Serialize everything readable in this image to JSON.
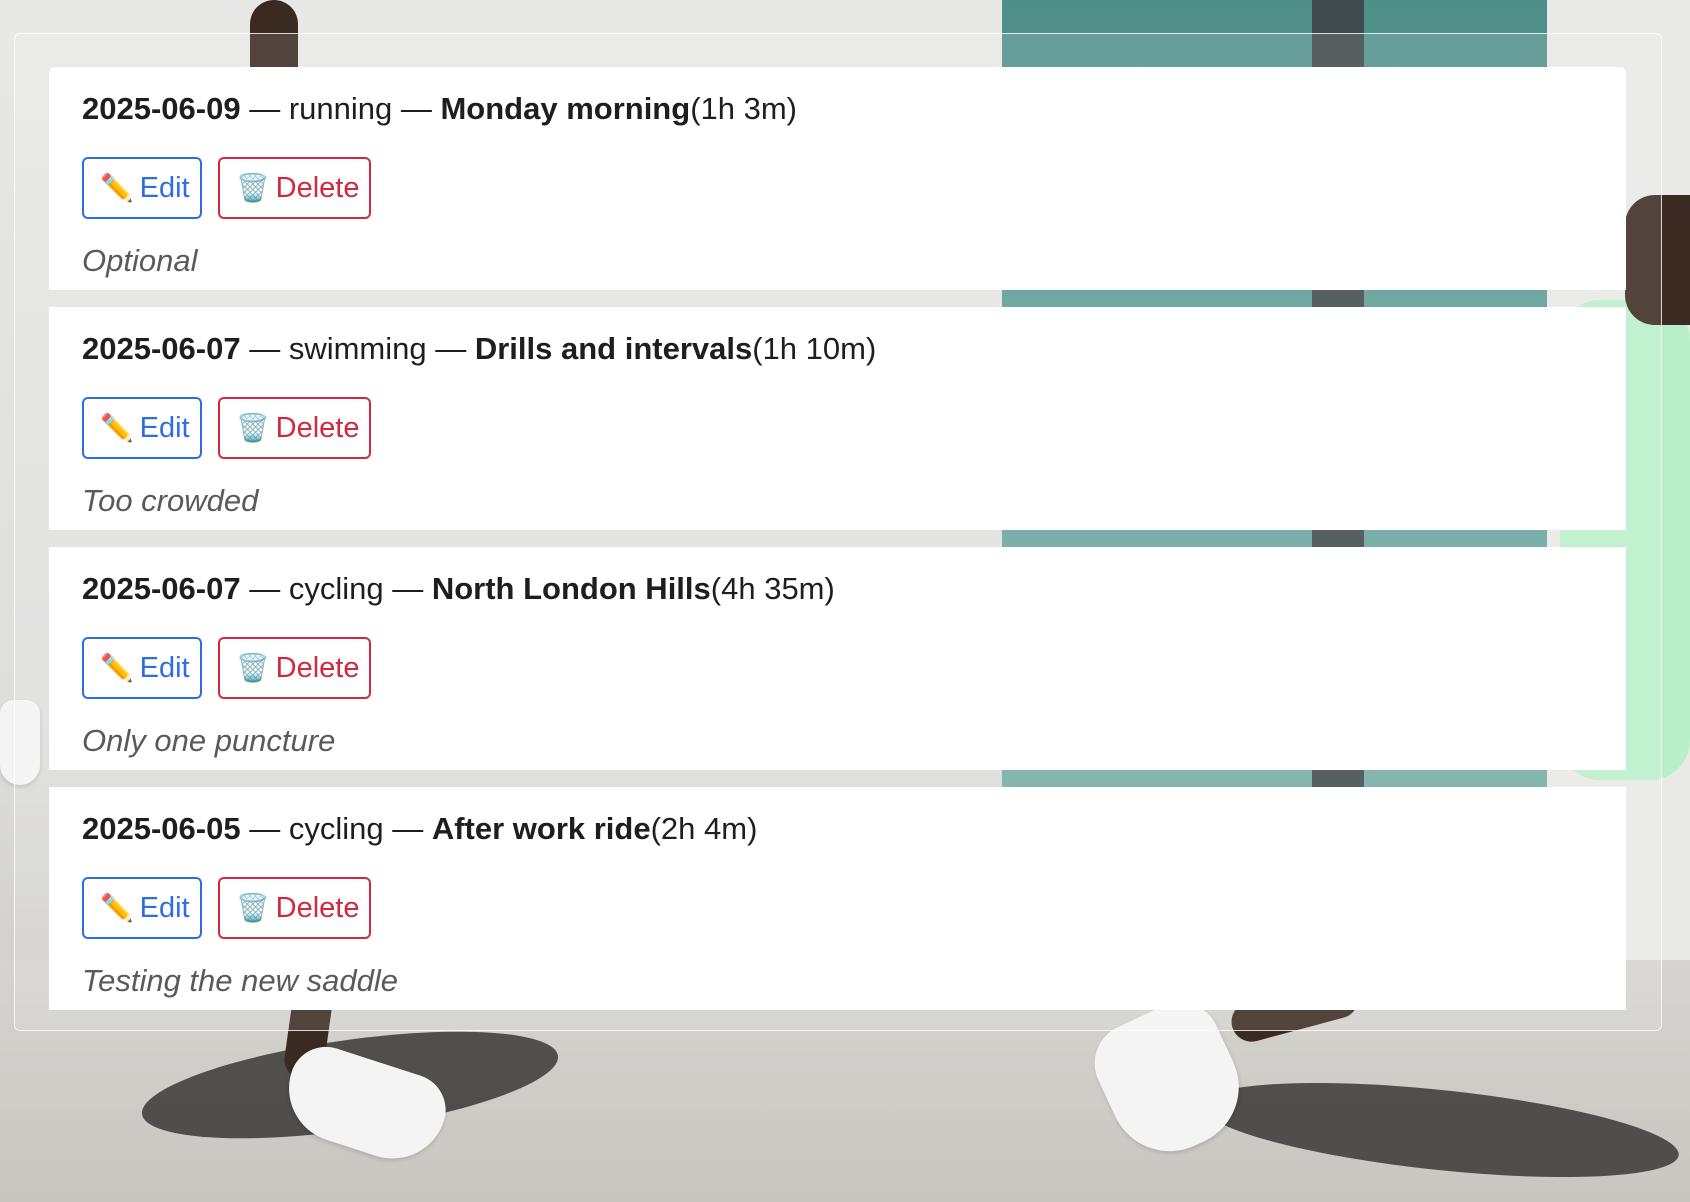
{
  "workouts": [
    {
      "date": "2025-06-09",
      "sep1": " — ",
      "sport": "running",
      "sep2": " — ",
      "title": "Monday morning",
      "duration": "(1h 3m)",
      "edit_label": "Edit",
      "delete_label": "Delete",
      "notes": "Optional"
    },
    {
      "date": "2025-06-07",
      "sep1": " — ",
      "sport": "swimming",
      "sep2": " — ",
      "title": "Drills and intervals",
      "duration": "(1h 10m)",
      "edit_label": "Edit",
      "delete_label": "Delete",
      "notes": "Too crowded"
    },
    {
      "date": "2025-06-07",
      "sep1": " — ",
      "sport": "cycling",
      "sep2": " — ",
      "title": "North London Hills",
      "duration": "(4h 35m)",
      "edit_label": "Edit",
      "delete_label": "Delete",
      "notes": "Only one puncture"
    },
    {
      "date": "2025-06-05",
      "sep1": " — ",
      "sport": "cycling",
      "sep2": " — ",
      "title": "After work ride",
      "duration": "(2h 4m)",
      "edit_label": "Edit",
      "delete_label": "Delete",
      "notes": "Testing the new saddle"
    }
  ],
  "icons": {
    "edit": "pencil-icon",
    "delete": "wastebasket-icon",
    "edit_glyph": "✏️",
    "delete_glyph": "🗑️"
  },
  "colors": {
    "edit_accent": "#2f6ee0",
    "delete_accent": "#d2283f",
    "notes_text": "#5a5a5a"
  }
}
